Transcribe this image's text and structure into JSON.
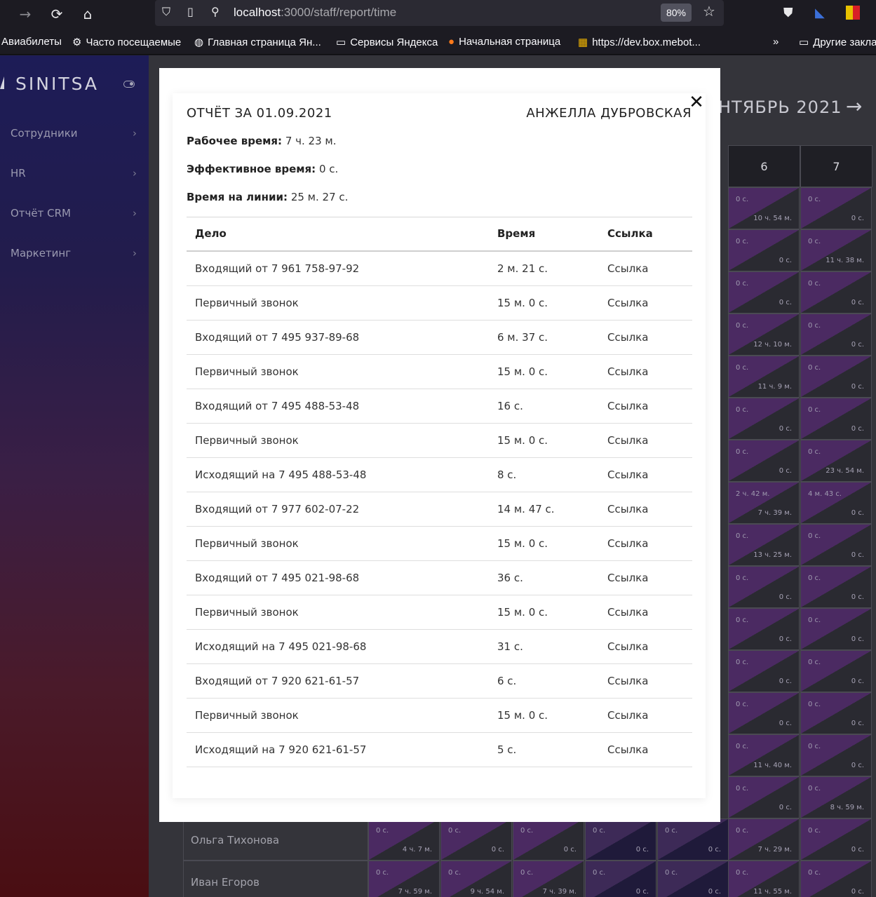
{
  "browser": {
    "url_host": "localhost",
    "url_path": ":3000/staff/report/time",
    "zoom": "80%",
    "bookmarks": [
      "Авиабилеты",
      "Часто посещаемые",
      "Главная страница Ян...",
      "Сервисы Яндекса",
      "Начальная страница",
      "https://dev.box.mebot...",
      "Другие закла"
    ]
  },
  "sidebar": {
    "brand": "SINITSA",
    "items": [
      {
        "label": "Сотрудники"
      },
      {
        "label": "HR"
      },
      {
        "label": "Отчёт CRM"
      },
      {
        "label": "Маркетинг"
      }
    ]
  },
  "calendar": {
    "month": "НТЯБРЬ 2021",
    "day_headers": [
      "6",
      "7"
    ],
    "col6": [
      [
        "0 с.",
        "10 ч. 54 м."
      ],
      [
        "0 с.",
        "0 с."
      ],
      [
        "0 с.",
        "0 с."
      ],
      [
        "0 с.",
        "12 ч. 10 м."
      ],
      [
        "0 с.",
        "11 ч. 9 м."
      ],
      [
        "0 с.",
        "0 с."
      ],
      [
        "0 с.",
        "0 с."
      ],
      [
        "2 ч. 42 м.",
        "7 ч. 39 м."
      ],
      [
        "0 с.",
        "13 ч. 25 м."
      ],
      [
        "0 с.",
        "0 с."
      ],
      [
        "0 с.",
        "0 с."
      ],
      [
        "0 с.",
        "0 с."
      ],
      [
        "0 с.",
        "0 с."
      ],
      [
        "0 с.",
        "11 ч. 40 м."
      ],
      [
        "0 с.",
        "0 с."
      ],
      [
        "0 с.",
        "7 ч. 29 м."
      ],
      [
        "0 с.",
        "11 ч. 55 м."
      ]
    ],
    "col7": [
      [
        "0 с.",
        "0 с."
      ],
      [
        "0 с.",
        "11 ч. 38 м."
      ],
      [
        "0 с.",
        "0 с."
      ],
      [
        "0 с.",
        "0 с."
      ],
      [
        "0 с.",
        "0 с."
      ],
      [
        "0 с.",
        "0 с."
      ],
      [
        "0 с.",
        "23 ч. 54 м."
      ],
      [
        "4 м. 43 с.",
        "0 с."
      ],
      [
        "0 с.",
        "0 с."
      ],
      [
        "0 с.",
        "0 с."
      ],
      [
        "0 с.",
        "0 с."
      ],
      [
        "0 с.",
        "0 с."
      ],
      [
        "0 с.",
        "0 с."
      ],
      [
        "0 с.",
        "0 с."
      ],
      [
        "0 с.",
        "8 ч. 59 м."
      ],
      [
        "0 с.",
        "0 с."
      ],
      [
        "0 с.",
        "0 с."
      ]
    ],
    "bottom_rows": [
      {
        "name": "Ольга Тихонова",
        "cells": [
          [
            "0 с.",
            "4 ч. 7 м."
          ],
          [
            "0 с.",
            "0 с."
          ],
          [
            "0 с.",
            "0 с."
          ],
          [
            "0 с.",
            "0 с."
          ],
          [
            "0 с.",
            "0 с."
          ]
        ]
      },
      {
        "name": "Иван Егоров",
        "cells": [
          [
            "0 с.",
            "7 ч. 59 м."
          ],
          [
            "0 с.",
            "9 ч. 54 м."
          ],
          [
            "0 с.",
            "7 ч. 39 м."
          ],
          [
            "0 с.",
            "0 с."
          ],
          [
            "0 с.",
            "0 с."
          ]
        ]
      }
    ]
  },
  "modal": {
    "title": "ОТЧЁТ ЗА 01.09.2021",
    "employee": "АНЖЕЛЛА ДУБРОВСКАЯ",
    "stats": [
      {
        "label": "Рабочее время:",
        "value": "7 ч. 23 м."
      },
      {
        "label": "Эффективное время:",
        "value": "0 с."
      },
      {
        "label": "Время на линии:",
        "value": "25 м. 27 с."
      }
    ],
    "columns": [
      "Дело",
      "Время",
      "Ссылка"
    ],
    "rows": [
      {
        "task": "Входящий от 7 961 758-97-92",
        "time": "2 м. 21 с.",
        "link": "Ссылка"
      },
      {
        "task": "Первичный звонок",
        "time": "15 м. 0 с.",
        "link": "Ссылка"
      },
      {
        "task": "Входящий от 7 495 937-89-68",
        "time": "6 м. 37 с.",
        "link": "Ссылка"
      },
      {
        "task": "Первичный звонок",
        "time": "15 м. 0 с.",
        "link": "Ссылка"
      },
      {
        "task": "Входящий от 7 495 488-53-48",
        "time": "16 с.",
        "link": "Ссылка"
      },
      {
        "task": "Первичный звонок",
        "time": "15 м. 0 с.",
        "link": "Ссылка"
      },
      {
        "task": "Исходящий на 7 495 488-53-48",
        "time": "8 с.",
        "link": "Ссылка"
      },
      {
        "task": "Входящий от 7 977 602-07-22",
        "time": "14 м. 47 с.",
        "link": "Ссылка"
      },
      {
        "task": "Первичный звонок",
        "time": "15 м. 0 с.",
        "link": "Ссылка"
      },
      {
        "task": "Входящий от 7 495 021-98-68",
        "time": "36 с.",
        "link": "Ссылка"
      },
      {
        "task": "Первичный звонок",
        "time": "15 м. 0 с.",
        "link": "Ссылка"
      },
      {
        "task": "Исходящий на 7 495 021-98-68",
        "time": "31 с.",
        "link": "Ссылка"
      },
      {
        "task": "Входящий от 7 920 621-61-57",
        "time": "6 с.",
        "link": "Ссылка"
      },
      {
        "task": "Первичный звонок",
        "time": "15 м. 0 с.",
        "link": "Ссылка"
      },
      {
        "task": "Исходящий на 7 920 621-61-57",
        "time": "5 с.",
        "link": "Ссылка"
      }
    ]
  }
}
